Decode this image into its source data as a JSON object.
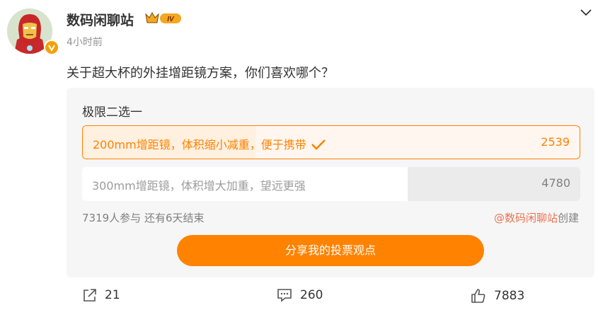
{
  "post": {
    "author": "数码闲聊站",
    "badge_level": "IV",
    "time": "4小时前",
    "text": "关于超大杯的外挂增距镜方案，你们喜欢哪个？"
  },
  "poll": {
    "title": "极限二选一",
    "options": [
      {
        "label": "200mm增距镜，体积缩小减重，便于携带",
        "count": "2539",
        "selected": true,
        "share": 0.347
      },
      {
        "label": "300mm增距镜，体积增大加重，望远更强",
        "count": "4780",
        "selected": false,
        "share": 0.653
      }
    ],
    "stats": "7319人参与 还有6天结束",
    "creator_link": "@数码闲聊站",
    "creator_suffix": "创建",
    "vote_button": "分享我的投票观点"
  },
  "actions": {
    "share_count": "21",
    "comment_count": "260",
    "like_count": "7883"
  },
  "colors": {
    "accent": "#ff8200",
    "link": "#eb7350",
    "muted": "#939393"
  }
}
